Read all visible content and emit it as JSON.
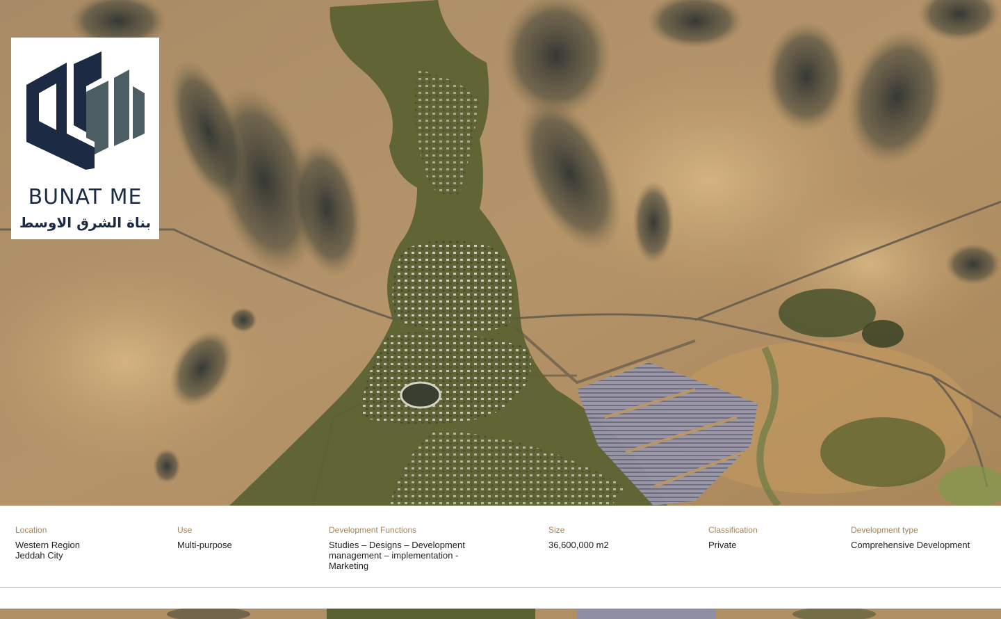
{
  "brand": {
    "name_en": "BUNAT ME",
    "name_ar": "بناة الشرق الاوسط",
    "colors": {
      "navy": "#1c2a44",
      "slate": "#4d5d64"
    }
  },
  "hero": {
    "image_subject": "aerial-masterplan-render",
    "colors": {
      "sand": "#b99767",
      "rock": "#3a3f3a",
      "vegetation": "#56602f",
      "solar": "#8a8aa0"
    }
  },
  "info": {
    "items": [
      {
        "label": "Location",
        "lines": [
          "Western Region",
          "Jeddah City"
        ]
      },
      {
        "label": "Use",
        "lines": [
          "Multi-purpose"
        ]
      },
      {
        "label": "Development Functions",
        "lines": [
          "Studies – Designs – Development",
          "management – implementation -",
          "Marketing"
        ]
      },
      {
        "label": "Size",
        "lines": [
          "36,600,000 m2"
        ]
      },
      {
        "label": "Classification",
        "lines": [
          "Private"
        ]
      },
      {
        "label": "Development type",
        "lines": [
          "Comprehensive Development"
        ]
      }
    ],
    "label_color": "#a3845a"
  }
}
